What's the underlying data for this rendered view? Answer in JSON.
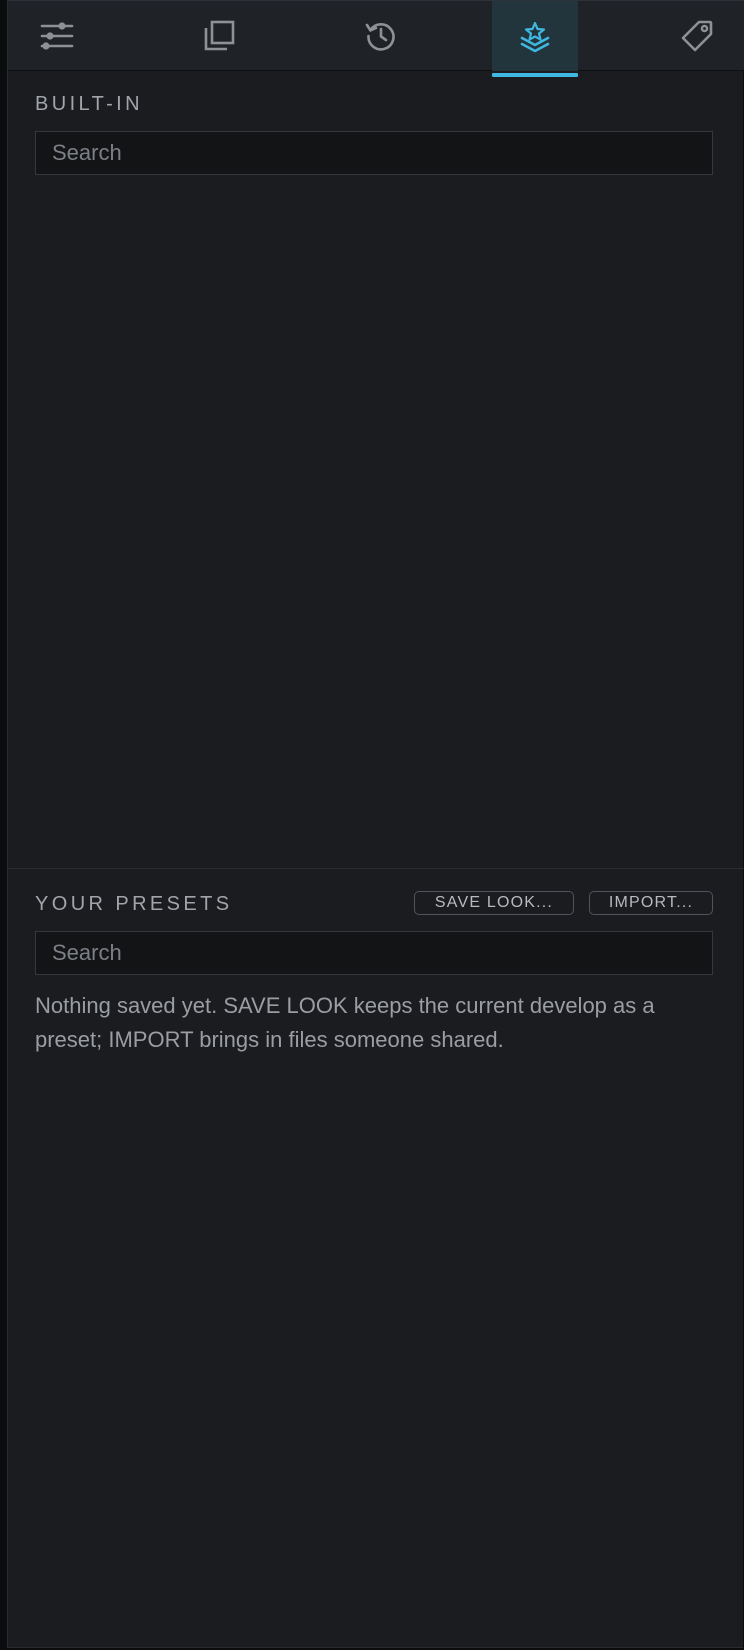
{
  "tabs": [
    {
      "icon": "sliders-icon",
      "active": false
    },
    {
      "icon": "copy-stack-icon",
      "active": false
    },
    {
      "icon": "history-icon",
      "active": false
    },
    {
      "icon": "presets-layers-icon",
      "active": true
    },
    {
      "icon": "tag-icon",
      "active": false
    }
  ],
  "accent_color": "#3fb7e0",
  "builtin": {
    "title": "BUILT-IN",
    "search_placeholder": "Search"
  },
  "your_presets": {
    "title": "YOUR PRESETS",
    "save_look_label": "SAVE LOOK...",
    "import_label": "IMPORT...",
    "search_placeholder": "Search",
    "empty_hint": "Nothing saved yet. SAVE LOOK keeps the current develop as a preset; IMPORT brings in files someone shared."
  }
}
